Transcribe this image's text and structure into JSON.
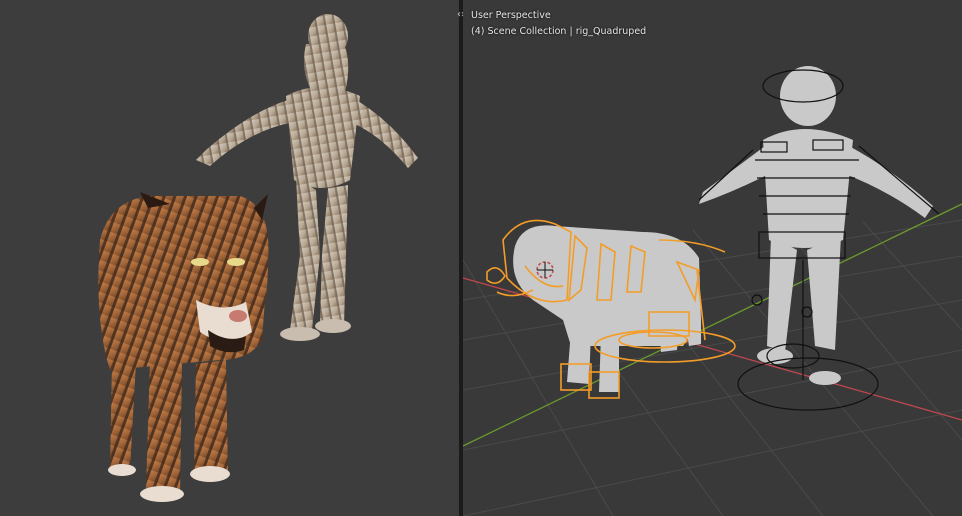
{
  "left_viewport": {
    "models": [
      "tiger-quadruped",
      "tiger-biped"
    ]
  },
  "right_viewport": {
    "view_name": "User Perspective",
    "collection_info": "(4) Scene Collection | rig_Quadruped",
    "colors": {
      "background": "#393939",
      "grid": "#4a4a4a",
      "x_axis": "#c0474f",
      "y_axis": "#6b9a2f",
      "selection": "#f39d28",
      "rig_lines": "#101010",
      "mesh": "#c9c9c9"
    }
  },
  "divider": {
    "handle_icon": "chevron-left-right-icon",
    "handle_glyph": "‹›"
  }
}
